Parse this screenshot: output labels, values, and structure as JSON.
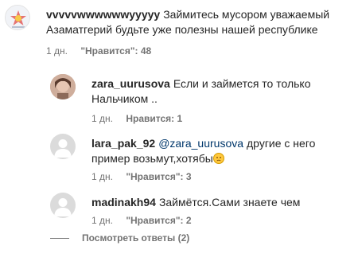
{
  "comments": [
    {
      "username": "vvvvvwwwwwwyyyyy",
      "text": "Займитесь мусором уважаемый Азаматгерий будьте уже полезны нашей республике",
      "time": "1 дн.",
      "likes": "\"Нравится\": 48"
    }
  ],
  "replies": [
    {
      "username": "zara_uurusova",
      "text": "Если и займется то только Нальчиком ..",
      "time": "1 дн.",
      "likes": "Нравится: 1"
    },
    {
      "username": "lara_pak_92",
      "mention": "@zara_uurusova",
      "text": "другие с него пример возьмут,хотябы",
      "emoji": "slightly-frowning-face-emoji",
      "time": "1 дн.",
      "likes": "\"Нравится\": 3"
    },
    {
      "username": "madinakh94",
      "text": "Займётся.Сами знаете чем",
      "time": "1 дн.",
      "likes": "\"Нравится\": 2"
    }
  ],
  "view_replies_label": "Посмотреть ответы (2)",
  "colors": {
    "text": "#262626",
    "meta": "#737373",
    "mention": "#00376b",
    "avatar_placeholder": "#dbdbdb"
  }
}
